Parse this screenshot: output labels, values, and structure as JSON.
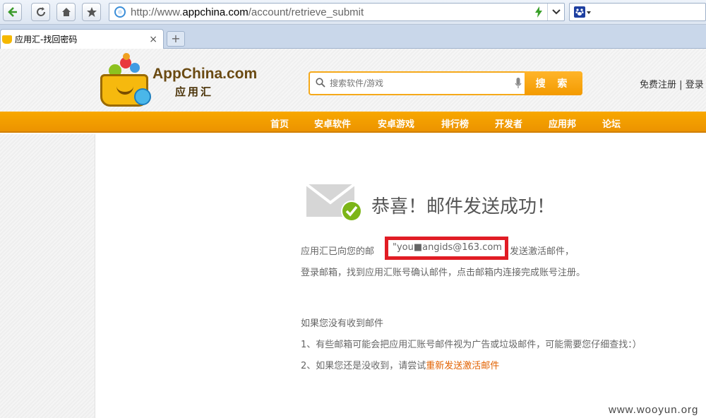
{
  "browser": {
    "url_prefix": "http://www.",
    "url_domain": "appchina.com",
    "url_path": "/account/retrieve_submit",
    "search_engine_icon": "baidu-paw-icon"
  },
  "tab": {
    "title": "应用汇-找回密码",
    "close": "×",
    "new_tab": "+"
  },
  "site": {
    "brand_name": "AppChina.com",
    "brand_sub": "应用汇",
    "search_placeholder": "搜索软件/游戏",
    "search_button": "搜 索",
    "register": "免费注册",
    "separator": "|",
    "login": "登录"
  },
  "nav": {
    "items": [
      "首页",
      "安卓软件",
      "安卓游戏",
      "排行榜",
      "开发者",
      "应用邦",
      "论坛"
    ]
  },
  "result": {
    "title": "恭喜！邮件发送成功！",
    "line1_prefix": "应用汇已向您的邮",
    "email": "\"you■angids@163.com",
    "line1_suffix": "发送激活邮件，",
    "line2": "登录邮箱，找到应用汇账号确认邮件，点击邮箱内连接完成账号注册。",
    "help_title": "如果您没有收到邮件",
    "help1": "1、有些邮箱可能会把应用汇账号邮件视为广告或垃圾邮件，可能需要您仔细查找：）",
    "help2_prefix": "2、如果您还是没收到，请尝试",
    "help2_link": "重新发送激活邮件"
  },
  "watermark": "www.wooyun.org",
  "colors": {
    "brand_orange": "#f39a00",
    "highlight_red": "#e11c24",
    "link_orange": "#e26100",
    "success_green": "#7cb518"
  }
}
